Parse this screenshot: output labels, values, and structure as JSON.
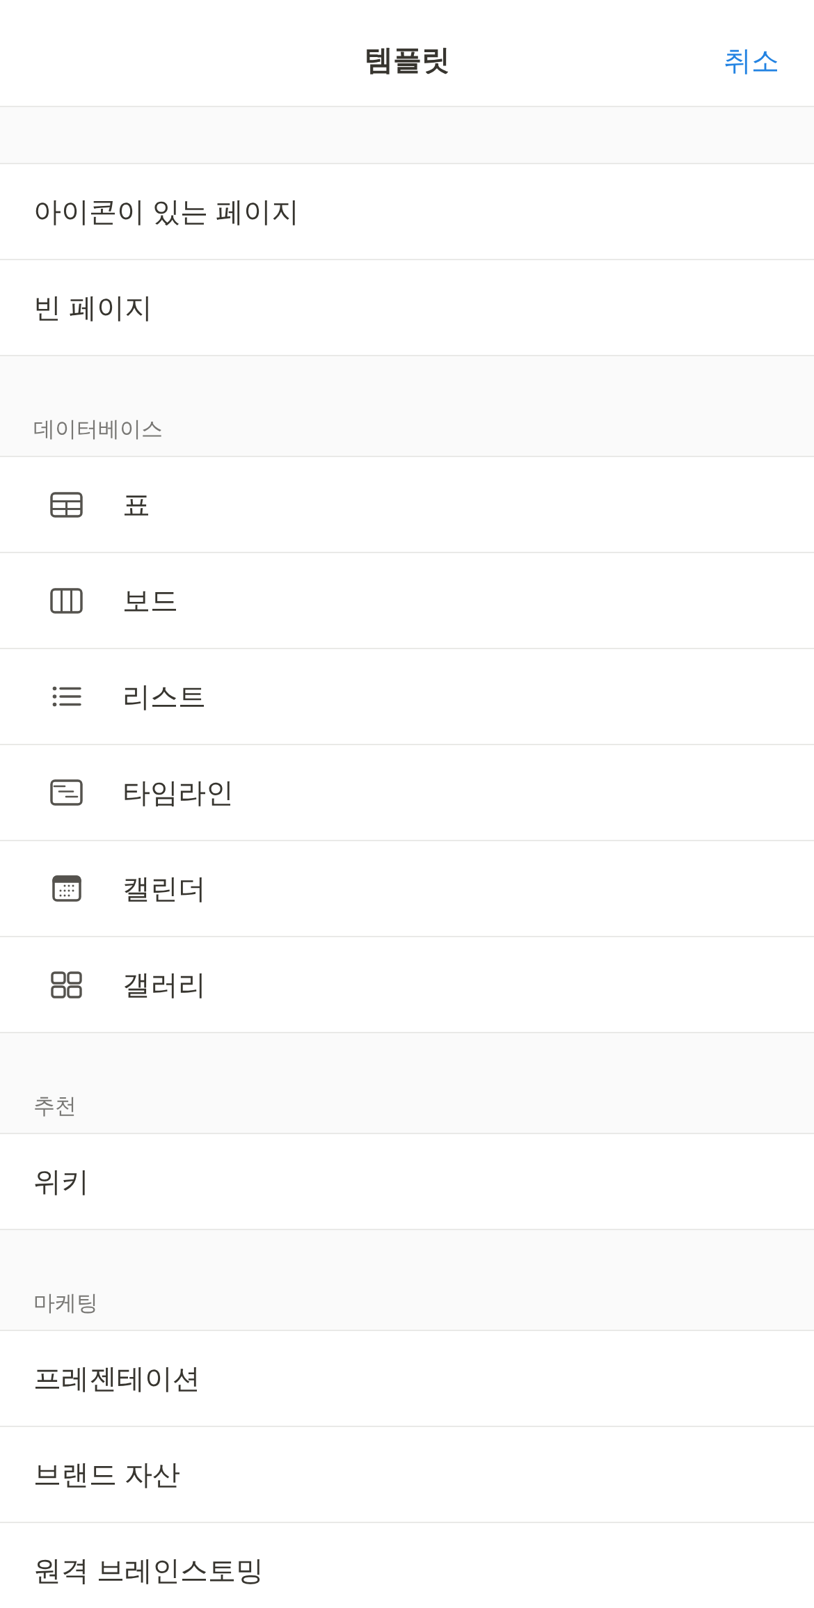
{
  "header": {
    "title": "템플릿",
    "cancel_button": "취소"
  },
  "sections": [
    {
      "items": [
        {
          "label": "아이콘이 있는 페이지"
        },
        {
          "label": "빈 페이지"
        }
      ]
    },
    {
      "title": "데이터베이스",
      "items": [
        {
          "label": "표",
          "kind": "table"
        },
        {
          "label": "보드",
          "kind": "board"
        },
        {
          "label": "리스트",
          "kind": "list"
        },
        {
          "label": "타임라인",
          "kind": "timeline"
        },
        {
          "label": "캘린더",
          "kind": "calendar"
        },
        {
          "label": "갤러리",
          "kind": "gallery"
        }
      ]
    },
    {
      "title": "추천",
      "items": [
        {
          "label": "위키"
        }
      ]
    },
    {
      "title": "마케팅",
      "items": [
        {
          "label": "프레젠테이션"
        },
        {
          "label": "브랜드 자산"
        },
        {
          "label": "원격 브레인스토밍"
        }
      ]
    }
  ]
}
